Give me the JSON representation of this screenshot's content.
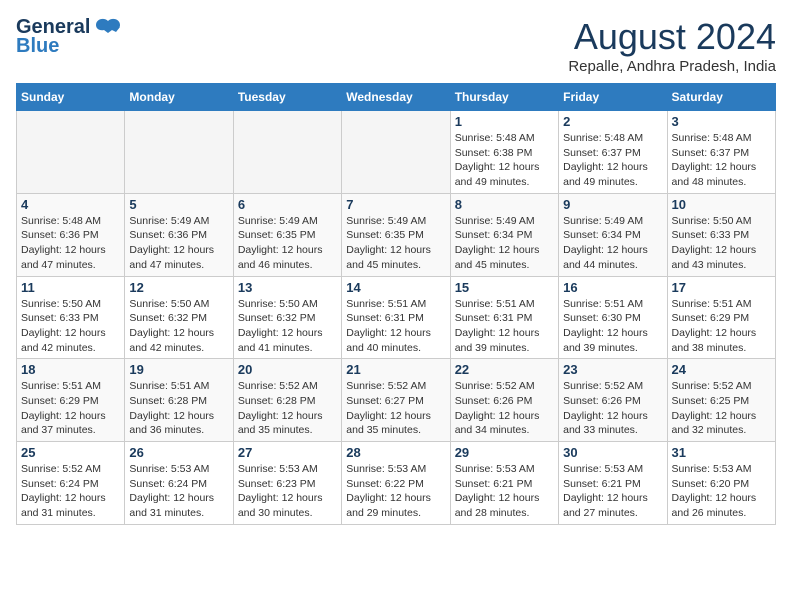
{
  "header": {
    "logo_general": "General",
    "logo_blue": "Blue",
    "month_year": "August 2024",
    "location": "Repalle, Andhra Pradesh, India"
  },
  "days_of_week": [
    "Sunday",
    "Monday",
    "Tuesday",
    "Wednesday",
    "Thursday",
    "Friday",
    "Saturday"
  ],
  "weeks": [
    [
      {
        "day": "",
        "empty": true
      },
      {
        "day": "",
        "empty": true
      },
      {
        "day": "",
        "empty": true
      },
      {
        "day": "",
        "empty": true
      },
      {
        "day": "1",
        "sunrise": "5:48 AM",
        "sunset": "6:38 PM",
        "daylight": "12 hours and 49 minutes."
      },
      {
        "day": "2",
        "sunrise": "5:48 AM",
        "sunset": "6:37 PM",
        "daylight": "12 hours and 49 minutes."
      },
      {
        "day": "3",
        "sunrise": "5:48 AM",
        "sunset": "6:37 PM",
        "daylight": "12 hours and 48 minutes."
      }
    ],
    [
      {
        "day": "4",
        "sunrise": "5:48 AM",
        "sunset": "6:36 PM",
        "daylight": "12 hours and 47 minutes."
      },
      {
        "day": "5",
        "sunrise": "5:49 AM",
        "sunset": "6:36 PM",
        "daylight": "12 hours and 47 minutes."
      },
      {
        "day": "6",
        "sunrise": "5:49 AM",
        "sunset": "6:35 PM",
        "daylight": "12 hours and 46 minutes."
      },
      {
        "day": "7",
        "sunrise": "5:49 AM",
        "sunset": "6:35 PM",
        "daylight": "12 hours and 45 minutes."
      },
      {
        "day": "8",
        "sunrise": "5:49 AM",
        "sunset": "6:34 PM",
        "daylight": "12 hours and 45 minutes."
      },
      {
        "day": "9",
        "sunrise": "5:49 AM",
        "sunset": "6:34 PM",
        "daylight": "12 hours and 44 minutes."
      },
      {
        "day": "10",
        "sunrise": "5:50 AM",
        "sunset": "6:33 PM",
        "daylight": "12 hours and 43 minutes."
      }
    ],
    [
      {
        "day": "11",
        "sunrise": "5:50 AM",
        "sunset": "6:33 PM",
        "daylight": "12 hours and 42 minutes."
      },
      {
        "day": "12",
        "sunrise": "5:50 AM",
        "sunset": "6:32 PM",
        "daylight": "12 hours and 42 minutes."
      },
      {
        "day": "13",
        "sunrise": "5:50 AM",
        "sunset": "6:32 PM",
        "daylight": "12 hours and 41 minutes."
      },
      {
        "day": "14",
        "sunrise": "5:51 AM",
        "sunset": "6:31 PM",
        "daylight": "12 hours and 40 minutes."
      },
      {
        "day": "15",
        "sunrise": "5:51 AM",
        "sunset": "6:31 PM",
        "daylight": "12 hours and 39 minutes."
      },
      {
        "day": "16",
        "sunrise": "5:51 AM",
        "sunset": "6:30 PM",
        "daylight": "12 hours and 39 minutes."
      },
      {
        "day": "17",
        "sunrise": "5:51 AM",
        "sunset": "6:29 PM",
        "daylight": "12 hours and 38 minutes."
      }
    ],
    [
      {
        "day": "18",
        "sunrise": "5:51 AM",
        "sunset": "6:29 PM",
        "daylight": "12 hours and 37 minutes."
      },
      {
        "day": "19",
        "sunrise": "5:51 AM",
        "sunset": "6:28 PM",
        "daylight": "12 hours and 36 minutes."
      },
      {
        "day": "20",
        "sunrise": "5:52 AM",
        "sunset": "6:28 PM",
        "daylight": "12 hours and 35 minutes."
      },
      {
        "day": "21",
        "sunrise": "5:52 AM",
        "sunset": "6:27 PM",
        "daylight": "12 hours and 35 minutes."
      },
      {
        "day": "22",
        "sunrise": "5:52 AM",
        "sunset": "6:26 PM",
        "daylight": "12 hours and 34 minutes."
      },
      {
        "day": "23",
        "sunrise": "5:52 AM",
        "sunset": "6:26 PM",
        "daylight": "12 hours and 33 minutes."
      },
      {
        "day": "24",
        "sunrise": "5:52 AM",
        "sunset": "6:25 PM",
        "daylight": "12 hours and 32 minutes."
      }
    ],
    [
      {
        "day": "25",
        "sunrise": "5:52 AM",
        "sunset": "6:24 PM",
        "daylight": "12 hours and 31 minutes."
      },
      {
        "day": "26",
        "sunrise": "5:53 AM",
        "sunset": "6:24 PM",
        "daylight": "12 hours and 31 minutes."
      },
      {
        "day": "27",
        "sunrise": "5:53 AM",
        "sunset": "6:23 PM",
        "daylight": "12 hours and 30 minutes."
      },
      {
        "day": "28",
        "sunrise": "5:53 AM",
        "sunset": "6:22 PM",
        "daylight": "12 hours and 29 minutes."
      },
      {
        "day": "29",
        "sunrise": "5:53 AM",
        "sunset": "6:21 PM",
        "daylight": "12 hours and 28 minutes."
      },
      {
        "day": "30",
        "sunrise": "5:53 AM",
        "sunset": "6:21 PM",
        "daylight": "12 hours and 27 minutes."
      },
      {
        "day": "31",
        "sunrise": "5:53 AM",
        "sunset": "6:20 PM",
        "daylight": "12 hours and 26 minutes."
      }
    ]
  ]
}
